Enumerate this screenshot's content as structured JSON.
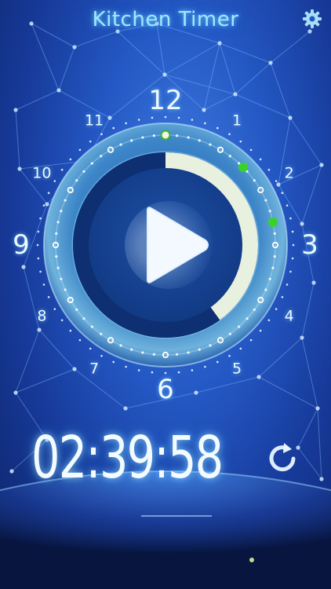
{
  "app": {
    "title": "Kitchen Timer"
  },
  "dial": {
    "numbers": [
      "12",
      "1",
      "2",
      "3",
      "4",
      "5",
      "6",
      "7",
      "8",
      "9",
      "10",
      "11"
    ],
    "progress_fraction": 0.4,
    "green_markers_minutes": [
      7.5,
      13
    ]
  },
  "timer": {
    "display": "02:39:58"
  },
  "icons": {
    "settings": "gear-icon",
    "play": "play-icon",
    "reset": "reset-icon"
  },
  "colors": {
    "accent_glow": "#9fe8ff",
    "marker_green": "#39d22a",
    "ring_progress": "#e8f0df"
  }
}
